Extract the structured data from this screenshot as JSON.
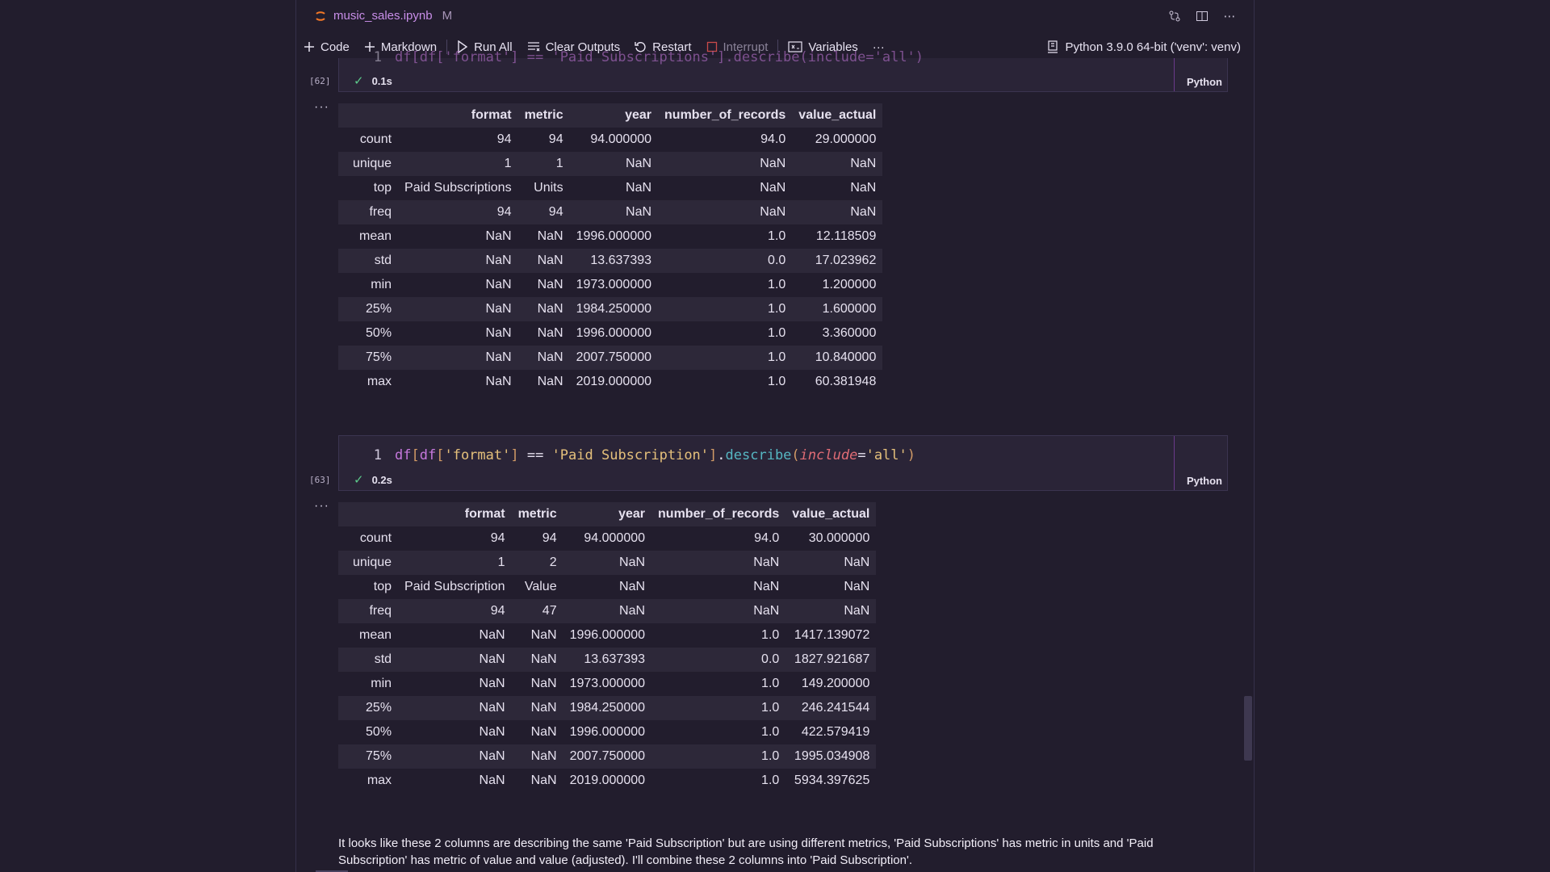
{
  "tab": {
    "filename": "music_sales.ipynb",
    "modified": "M"
  },
  "toolbar": {
    "code": "Code",
    "markdown": "Markdown",
    "run_all": "Run All",
    "clear_outputs": "Clear Outputs",
    "restart": "Restart",
    "interrupt": "Interrupt",
    "variables": "Variables",
    "more": "···",
    "kernel": "Python 3.9.0 64-bit ('venv': venv)"
  },
  "cell62": {
    "partial_code": "df[df['format'] == 'Paid Subscriptions'].describe(include='all')",
    "exec_count": "[62]",
    "time": "0.1s",
    "lang": "Python",
    "output_ellipsis": "···",
    "table": {
      "columns": [
        "",
        "format",
        "metric",
        "year",
        "number_of_records",
        "value_actual"
      ],
      "rows": [
        [
          "count",
          "94",
          "94",
          "94.000000",
          "94.0",
          "29.000000"
        ],
        [
          "unique",
          "1",
          "1",
          "NaN",
          "NaN",
          "NaN"
        ],
        [
          "top",
          "Paid Subscriptions",
          "Units",
          "NaN",
          "NaN",
          "NaN"
        ],
        [
          "freq",
          "94",
          "94",
          "NaN",
          "NaN",
          "NaN"
        ],
        [
          "mean",
          "NaN",
          "NaN",
          "1996.000000",
          "1.0",
          "12.118509"
        ],
        [
          "std",
          "NaN",
          "NaN",
          "13.637393",
          "0.0",
          "17.023962"
        ],
        [
          "min",
          "NaN",
          "NaN",
          "1973.000000",
          "1.0",
          "1.200000"
        ],
        [
          "25%",
          "NaN",
          "NaN",
          "1984.250000",
          "1.0",
          "1.600000"
        ],
        [
          "50%",
          "NaN",
          "NaN",
          "1996.000000",
          "1.0",
          "3.360000"
        ],
        [
          "75%",
          "NaN",
          "NaN",
          "2007.750000",
          "1.0",
          "10.840000"
        ],
        [
          "max",
          "NaN",
          "NaN",
          "2019.000000",
          "1.0",
          "60.381948"
        ]
      ]
    }
  },
  "cell63": {
    "line_number": "1",
    "code_tokens": {
      "t1": "df",
      "t2": "[",
      "t3": "df",
      "t4": "[",
      "t5": "'format'",
      "t6": "]",
      "t7": " == ",
      "t8": "'Paid Subscription'",
      "t9": "]",
      "t10": ".",
      "t11": "describe",
      "t12": "(",
      "t13": "include",
      "t14": "=",
      "t15": "'all'",
      "t16": ")"
    },
    "exec_count": "[63]",
    "time": "0.2s",
    "lang": "Python",
    "output_ellipsis": "···",
    "table": {
      "columns": [
        "",
        "format",
        "metric",
        "year",
        "number_of_records",
        "value_actual"
      ],
      "rows": [
        [
          "count",
          "94",
          "94",
          "94.000000",
          "94.0",
          "30.000000"
        ],
        [
          "unique",
          "1",
          "2",
          "NaN",
          "NaN",
          "NaN"
        ],
        [
          "top",
          "Paid Subscription",
          "Value",
          "NaN",
          "NaN",
          "NaN"
        ],
        [
          "freq",
          "94",
          "47",
          "NaN",
          "NaN",
          "NaN"
        ],
        [
          "mean",
          "NaN",
          "NaN",
          "1996.000000",
          "1.0",
          "1417.139072"
        ],
        [
          "std",
          "NaN",
          "NaN",
          "13.637393",
          "0.0",
          "1827.921687"
        ],
        [
          "min",
          "NaN",
          "NaN",
          "1973.000000",
          "1.0",
          "149.200000"
        ],
        [
          "25%",
          "NaN",
          "NaN",
          "1984.250000",
          "1.0",
          "246.241544"
        ],
        [
          "50%",
          "NaN",
          "NaN",
          "1996.000000",
          "1.0",
          "422.579419"
        ],
        [
          "75%",
          "NaN",
          "NaN",
          "2007.750000",
          "1.0",
          "1995.034908"
        ],
        [
          "max",
          "NaN",
          "NaN",
          "2019.000000",
          "1.0",
          "5934.397625"
        ]
      ]
    }
  },
  "markdown": {
    "text": "It looks like these 2 columns are describing the same 'Paid Subscription' but are using different metrics, 'Paid Subscriptions' has metric in units and 'Paid Subscription' has metric of value and value (adjusted). I'll combine these 2 columns into 'Paid Subscription'."
  }
}
